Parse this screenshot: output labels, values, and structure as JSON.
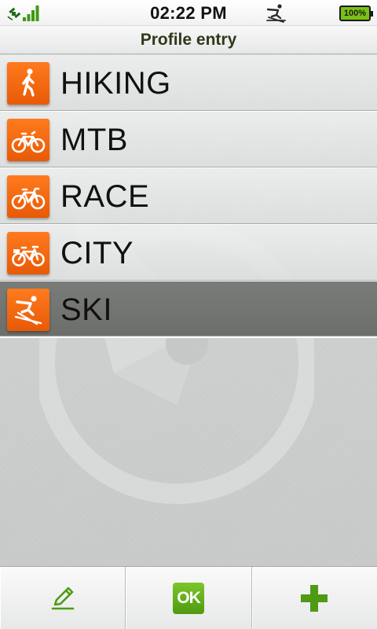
{
  "status_bar": {
    "time": "02:22 PM",
    "battery": "100%",
    "icons": [
      "satellite-icon",
      "signal-strength-icon",
      "ski-activity-icon",
      "battery-icon"
    ]
  },
  "header": {
    "title": "Profile entry"
  },
  "profiles": [
    {
      "label": "HIKING",
      "icon": "hiking-icon",
      "selected": false
    },
    {
      "label": "MTB",
      "icon": "mountain-bike-icon",
      "selected": false
    },
    {
      "label": "RACE",
      "icon": "race-bike-icon",
      "selected": false
    },
    {
      "label": "CITY",
      "icon": "city-bike-icon",
      "selected": false
    },
    {
      "label": "SKI",
      "icon": "ski-icon",
      "selected": true
    }
  ],
  "toolbar": {
    "edit_icon": "pencil-icon",
    "ok_label": "OK",
    "add_icon": "plus-icon"
  },
  "colors": {
    "accent_orange": "#f06a10",
    "ok_green": "#5aa518",
    "selected_row": "#737572"
  }
}
